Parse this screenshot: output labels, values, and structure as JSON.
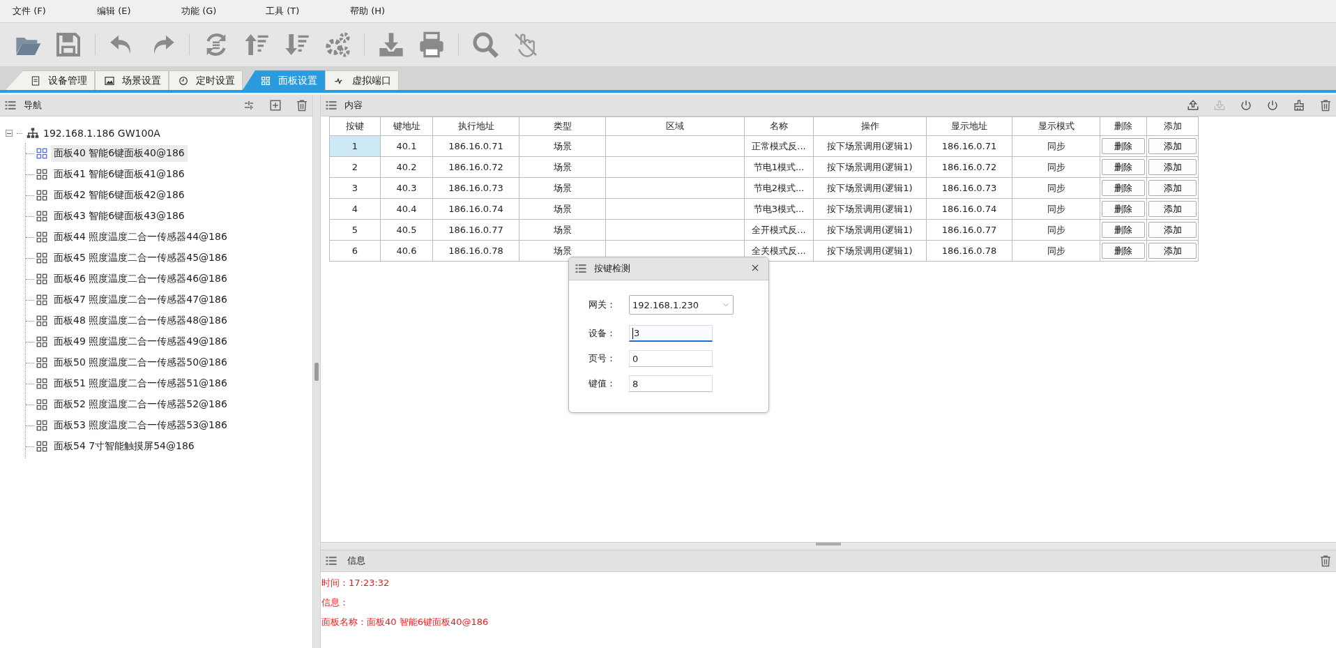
{
  "menu": [
    "文件 (F)",
    "编辑 (E)",
    "功能 (G)",
    "工具 (T)",
    "帮助 (H)"
  ],
  "tabs": [
    {
      "label": "设备管理",
      "selected": false
    },
    {
      "label": "场景设置",
      "selected": false
    },
    {
      "label": "定时设置",
      "selected": false
    },
    {
      "label": "面板设置",
      "selected": true
    },
    {
      "label": "虚拟端口",
      "selected": false
    }
  ],
  "nav": {
    "title": "导航",
    "root": {
      "label": "192.168.1.186 GW100A",
      "expanded": true,
      "children": [
        {
          "label": "面板40 智能6键面板40@186",
          "selected": true
        },
        {
          "label": "面板41 智能6键面板41@186",
          "selected": false
        },
        {
          "label": "面板42 智能6键面板42@186",
          "selected": false
        },
        {
          "label": "面板43 智能6键面板43@186",
          "selected": false
        },
        {
          "label": "面板44 照度温度二合一传感器44@186",
          "selected": false
        },
        {
          "label": "面板45 照度温度二合一传感器45@186",
          "selected": false
        },
        {
          "label": "面板46 照度温度二合一传感器46@186",
          "selected": false
        },
        {
          "label": "面板47 照度温度二合一传感器47@186",
          "selected": false
        },
        {
          "label": "面板48 照度温度二合一传感器48@186",
          "selected": false
        },
        {
          "label": "面板49 照度温度二合一传感器49@186",
          "selected": false
        },
        {
          "label": "面板50 照度温度二合一传感器50@186",
          "selected": false
        },
        {
          "label": "面板51 照度温度二合一传感器51@186",
          "selected": false
        },
        {
          "label": "面板52 照度温度二合一传感器52@186",
          "selected": false
        },
        {
          "label": "面板53 照度温度二合一传感器53@186",
          "selected": false
        },
        {
          "label": "面板54 7寸智能触摸屏54@186",
          "selected": false
        }
      ]
    }
  },
  "content": {
    "title": "内容",
    "table": {
      "columns": [
        "按键",
        "键地址",
        "执行地址",
        "类型",
        "区域",
        "名称",
        "操作",
        "显示地址",
        "显示模式",
        "删除",
        "添加"
      ],
      "rows": [
        {
          "cells": [
            "1",
            "40.1",
            "186.16.0.71",
            "场景",
            "",
            "正常模式反...",
            "按下场景调用(逻辑1)",
            "186.16.0.71",
            "同步"
          ],
          "buttons": [
            "删除",
            "添加"
          ],
          "selected": true
        },
        {
          "cells": [
            "2",
            "40.2",
            "186.16.0.72",
            "场景",
            "",
            "节电1模式...",
            "按下场景调用(逻辑1)",
            "186.16.0.72",
            "同步"
          ],
          "buttons": [
            "删除",
            "添加"
          ],
          "selected": false
        },
        {
          "cells": [
            "3",
            "40.3",
            "186.16.0.73",
            "场景",
            "",
            "节电2模式...",
            "按下场景调用(逻辑1)",
            "186.16.0.73",
            "同步"
          ],
          "buttons": [
            "删除",
            "添加"
          ],
          "selected": false
        },
        {
          "cells": [
            "4",
            "40.4",
            "186.16.0.74",
            "场景",
            "",
            "节电3模式...",
            "按下场景调用(逻辑1)",
            "186.16.0.74",
            "同步"
          ],
          "buttons": [
            "删除",
            "添加"
          ],
          "selected": false
        },
        {
          "cells": [
            "5",
            "40.5",
            "186.16.0.77",
            "场景",
            "",
            "全开模式反...",
            "按下场景调用(逻辑1)",
            "186.16.0.77",
            "同步"
          ],
          "buttons": [
            "删除",
            "添加"
          ],
          "selected": false
        },
        {
          "cells": [
            "6",
            "40.6",
            "186.16.0.78",
            "场景",
            "",
            "全关模式反...",
            "按下场景调用(逻辑1)",
            "186.16.0.78",
            "同步"
          ],
          "buttons": [
            "删除",
            "添加"
          ],
          "selected": false
        }
      ]
    }
  },
  "dialog": {
    "title": "按键检测",
    "fields": [
      {
        "kind": "select",
        "label": "网关：",
        "value": "192.168.1.230"
      },
      {
        "kind": "input",
        "label": "设备：",
        "value": "3",
        "focused": true
      },
      {
        "kind": "input",
        "label": "页号：",
        "value": "0",
        "focused": false
      },
      {
        "kind": "input",
        "label": "键值：",
        "value": "8",
        "focused": false
      }
    ]
  },
  "info": {
    "title": "信息",
    "lines": [
      "时间：17:23:32",
      "信息：",
      "面板名称：面板40 智能6键面板40@186"
    ]
  }
}
